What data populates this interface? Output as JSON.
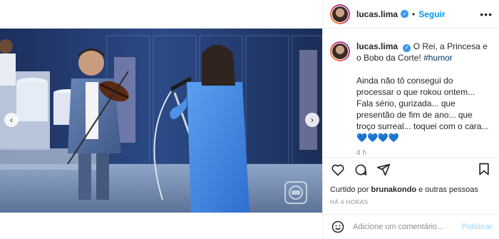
{
  "header": {
    "username": "lucas.lima",
    "separator": "•",
    "follow_label": "Seguir",
    "more_label": "•••"
  },
  "caption": {
    "username": "lucas.lima",
    "text": "O Rei, a Princesa e o Bobo da Corte!",
    "hashtag": "#humor",
    "body": "Ainda não tô consegui do processar o que rokou ontem... Fala sério, gurizada... que presentão de fim de ano... que troço surreal... toquei com o cara...",
    "hearts": "💙💙💙💙",
    "time": "4 h"
  },
  "likes": {
    "prefix": "Curtido por",
    "user": "brunakondo",
    "suffix": "e outras pessoas"
  },
  "posted_ago": "HÁ 4 HORAS",
  "comment_box": {
    "placeholder": "Adicione um comentário...",
    "publish_label": "Publicar"
  },
  "video": {
    "watermark": "globo"
  },
  "icons": {
    "prev": "chevron-left-icon",
    "next": "chevron-right-icon",
    "like": "heart-icon",
    "comment": "comment-icon",
    "share": "share-icon",
    "save": "bookmark-icon",
    "emoji": "smiley-icon",
    "verified": "verified-badge-icon"
  },
  "colors": {
    "accent": "#0095f6",
    "verified": "#3897f0",
    "publish_disabled": "#b2dffc",
    "hashtag": "#00376b"
  }
}
